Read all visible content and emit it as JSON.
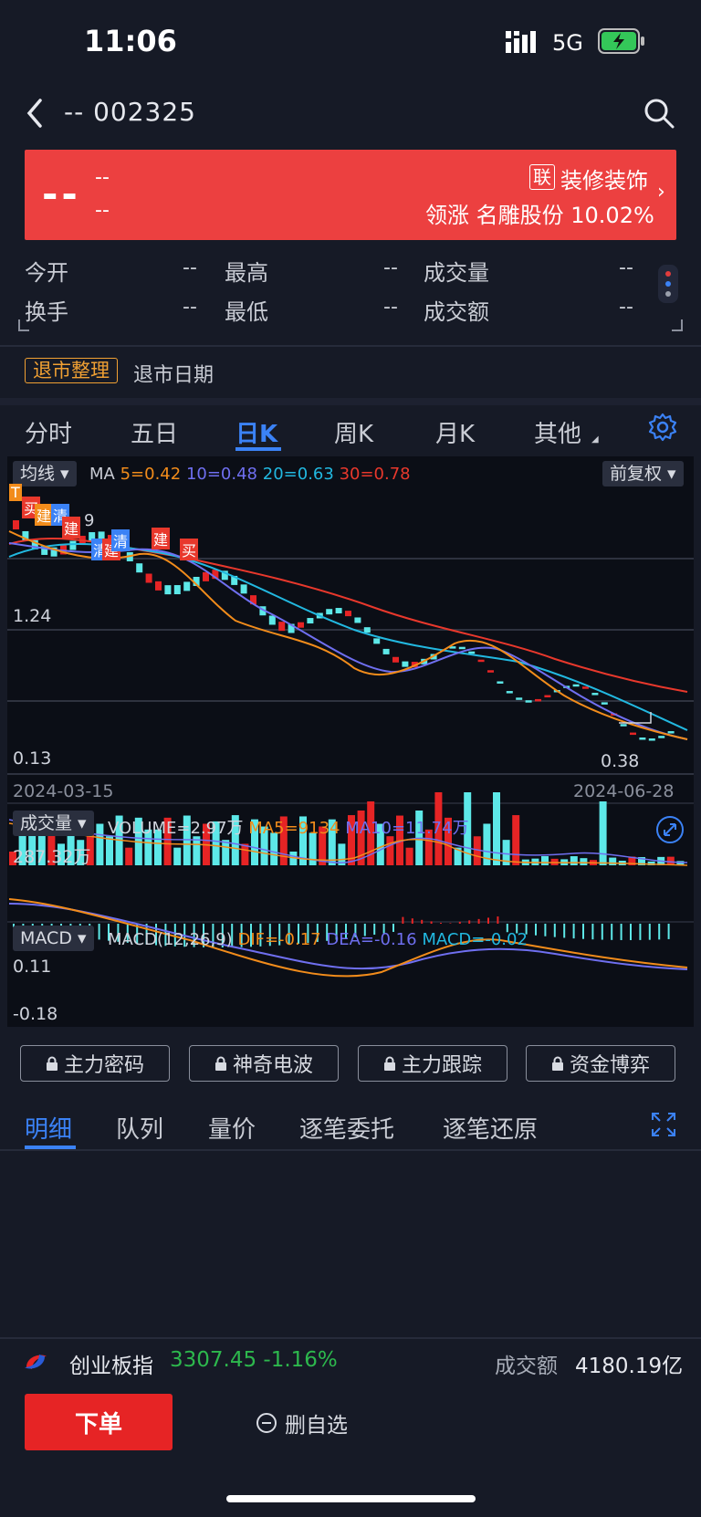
{
  "status": {
    "time": "11:06",
    "network": "5G"
  },
  "header": {
    "title": "-- 002325"
  },
  "banner": {
    "price": "--",
    "change_amount": "--",
    "change_pct": "--",
    "link_tag": "联",
    "sector": "装修装饰",
    "leader": "领涨 名雕股份 10.02%",
    "color": "#ec4040"
  },
  "stats": [
    {
      "label": "今开",
      "value": "--"
    },
    {
      "label": "最高",
      "value": "--"
    },
    {
      "label": "成交量",
      "value": "--"
    },
    {
      "label": "换手",
      "value": "--"
    },
    {
      "label": "最低",
      "value": "--"
    },
    {
      "label": "成交额",
      "value": "--"
    }
  ],
  "delist": {
    "tag": "退市整理",
    "date_label": "退市日期"
  },
  "period_tabs": [
    "分时",
    "五日",
    "日K",
    "周K",
    "月K",
    "其他"
  ],
  "active_period": "日K",
  "kline": {
    "indicator_button": "均线",
    "ma_label": "MA",
    "ma5": "5=0.42",
    "ma10": "10=0.48",
    "ma20": "20=0.63",
    "ma30": "30=0.78",
    "adjust_button": "前复权",
    "price_top": "1.24",
    "price_bottom": "0.13",
    "last_price": "0.38",
    "date_start": "2024-03-15",
    "date_end": "2024-06-28",
    "markers": [
      "T",
      "买",
      "建",
      "清",
      "建",
      "清",
      "建",
      "清",
      "建",
      "买"
    ],
    "marker_partial": "9"
  },
  "volume": {
    "button": "成交量",
    "text": "VOLUME=2.97万",
    "ma5": "MA5=9134",
    "ma10": "MA10=11.74万",
    "max": "287.32万"
  },
  "macd": {
    "button": "MACD",
    "params": "MACD(12,26,9)",
    "dif": "DIF=-0.17",
    "dea": "DEA=-0.16",
    "macd": "MACD=-0.02",
    "top": "0.11",
    "bottom": "-0.18"
  },
  "locked_tools": [
    "主力密码",
    "神奇电波",
    "主力跟踪",
    "资金博弈"
  ],
  "detail_tabs": [
    "明细",
    "队列",
    "量价",
    "逐笔委托",
    "逐笔还原"
  ],
  "index_bar": {
    "name": "创业板指",
    "value": "3307.45  -1.16%",
    "amount_label": "成交额",
    "amount": "4180.19亿"
  },
  "actions": {
    "order": "下单",
    "remove_fav": "删自选"
  },
  "colors": {
    "up": "#e62425",
    "down": "#5de8e8",
    "accent": "#3b82f6",
    "ma5": "#f28c1b",
    "ma10": "#6f6ff0",
    "ma20": "#22b8e0",
    "ma30": "#e8382c"
  }
}
